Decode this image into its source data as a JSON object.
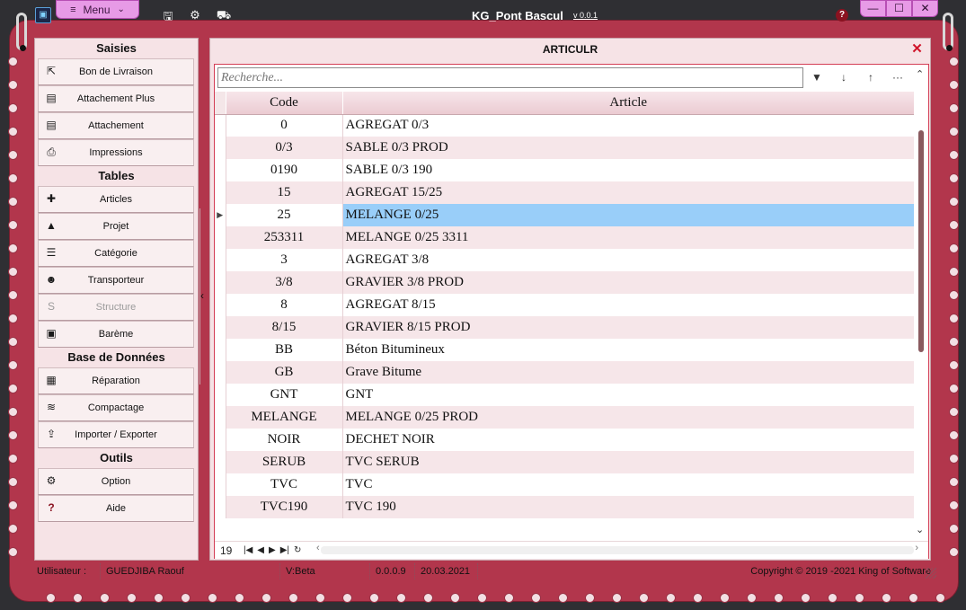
{
  "app": {
    "title": "KG_Pont Bascul",
    "version": "v 0.0.1",
    "menu_label": "Menu",
    "win_min": "—",
    "win_max": "☐",
    "win_close": "✕"
  },
  "sidebar": {
    "sections": [
      {
        "title": "Saisies",
        "items": [
          {
            "label": "Bon de Livraison",
            "icon": "export-icon"
          },
          {
            "label": "Attachement Plus",
            "icon": "list-window-icon"
          },
          {
            "label": "Attachement",
            "icon": "list-window-icon"
          },
          {
            "label": "Impressions",
            "icon": "printer-icon"
          }
        ]
      },
      {
        "title": "Tables",
        "items": [
          {
            "label": "Articles",
            "icon": "puzzle-icon"
          },
          {
            "label": "Projet",
            "icon": "road-icon"
          },
          {
            "label": "Catégorie",
            "icon": "list-icon"
          },
          {
            "label": "Transporteur",
            "icon": "users-icon"
          },
          {
            "label": "Structure",
            "icon": "structure-icon",
            "disabled": true
          },
          {
            "label": "Barème",
            "icon": "money-icon"
          }
        ]
      },
      {
        "title": "Base de Données",
        "items": [
          {
            "label": "Réparation",
            "icon": "toolbox-icon"
          },
          {
            "label": "Compactage",
            "icon": "compress-icon"
          },
          {
            "label": "Importer  / Exporter",
            "icon": "upload-icon"
          }
        ]
      },
      {
        "title": "Outils",
        "items": [
          {
            "label": "Option",
            "icon": "gears-icon"
          },
          {
            "label": "Aide",
            "icon": "help-icon"
          }
        ]
      }
    ]
  },
  "panel": {
    "title": "ARTICULR",
    "search_placeholder": "Recherche...",
    "columns": [
      "Code",
      "Article"
    ],
    "rows": [
      {
        "code": "0",
        "article": "AGREGAT 0/3"
      },
      {
        "code": "0/3",
        "article": "SABLE 0/3 PROD"
      },
      {
        "code": "0190",
        "article": "SABLE 0/3 190"
      },
      {
        "code": "15",
        "article": "AGREGAT 15/25"
      },
      {
        "code": "25",
        "article": "MELANGE 0/25"
      },
      {
        "code": "253311",
        "article": "MELANGE 0/25 3311"
      },
      {
        "code": "3",
        "article": "AGREGAT 3/8"
      },
      {
        "code": "3/8",
        "article": "GRAVIER 3/8 PROD"
      },
      {
        "code": "8",
        "article": "AGREGAT 8/15"
      },
      {
        "code": "8/15",
        "article": "GRAVIER 8/15 PROD"
      },
      {
        "code": "BB",
        "article": "Béton Bitumineux"
      },
      {
        "code": "GB",
        "article": "Grave Bitume"
      },
      {
        "code": "GNT",
        "article": "GNT"
      },
      {
        "code": "MELANGE",
        "article": "MELANGE 0/25 PROD"
      },
      {
        "code": "NOIR",
        "article": "DECHET NOIR"
      },
      {
        "code": "SERUB",
        "article": "TVC SERUB"
      },
      {
        "code": "TVC",
        "article": "TVC"
      },
      {
        "code": "TVC190",
        "article": "TVC 190"
      }
    ],
    "selected_index": 4,
    "record_count": "19"
  },
  "status": {
    "user_label": "Utilisateur :",
    "user_name": "GUEDJIBA Raouf",
    "build": "V:Beta",
    "version": "0.0.0.9",
    "date": "20.03.2021",
    "copyright": "Copyright © 2019 -2021 King of Software"
  },
  "colors": {
    "frame": "#b2364c",
    "panel_bg": "#f6e3e6",
    "accent_pink": "#e79ae6",
    "selection": "#99cef9",
    "close_red": "#d0142a"
  }
}
